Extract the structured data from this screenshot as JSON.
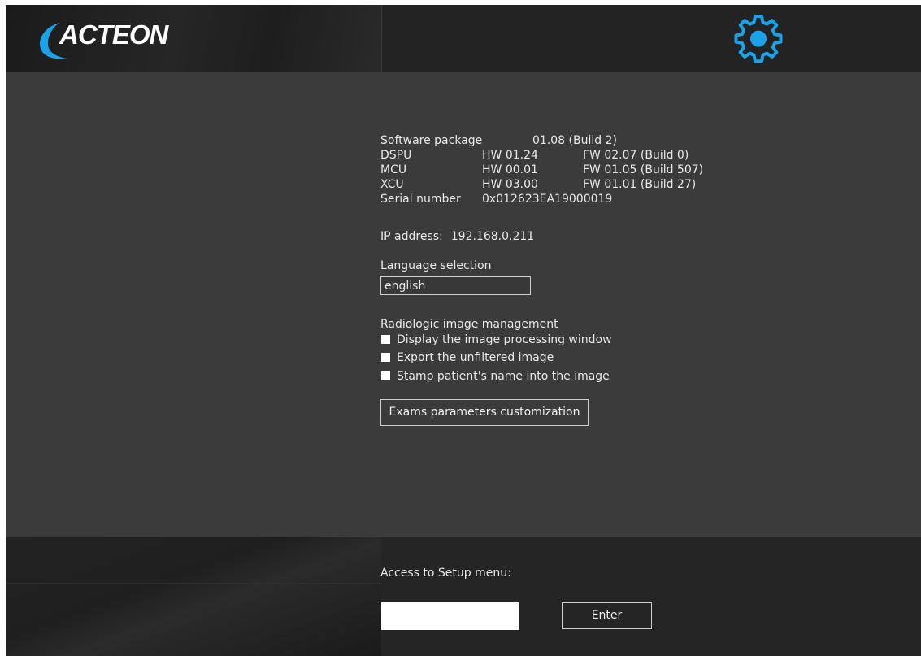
{
  "header": {
    "logo_text": "ACTEON",
    "settings_icon": "gear-icon",
    "accent_color": "#1aa3e8"
  },
  "info": {
    "software_package": {
      "label": "Software package",
      "value": "01.08 (Build 2)"
    },
    "dspu": {
      "label": "DSPU",
      "hw": "HW 01.24",
      "fw": "FW 02.07 (Build 0)"
    },
    "mcu": {
      "label": "MCU",
      "hw": "HW 00.01",
      "fw": "FW 01.05 (Build 507)"
    },
    "xcu": {
      "label": "XCU",
      "hw": "HW 03.00",
      "fw": "FW 01.01 (Build 27)"
    },
    "serial": {
      "label": "Serial number",
      "value": "0x012623EA19000019"
    }
  },
  "ip": {
    "label": "IP address:",
    "value": "192.168.0.211"
  },
  "language": {
    "label": "Language selection",
    "selected": "english"
  },
  "radiologic": {
    "label": "Radiologic image management",
    "options": [
      {
        "label": "Display the image processing window",
        "checked": false
      },
      {
        "label": "Export the unfiltered image",
        "checked": false
      },
      {
        "label": "Stamp patient's name into the image",
        "checked": false
      }
    ]
  },
  "exams_button": "Exams parameters customization",
  "setup": {
    "label": "Access to Setup menu:",
    "input_value": "",
    "enter_button": "Enter"
  }
}
